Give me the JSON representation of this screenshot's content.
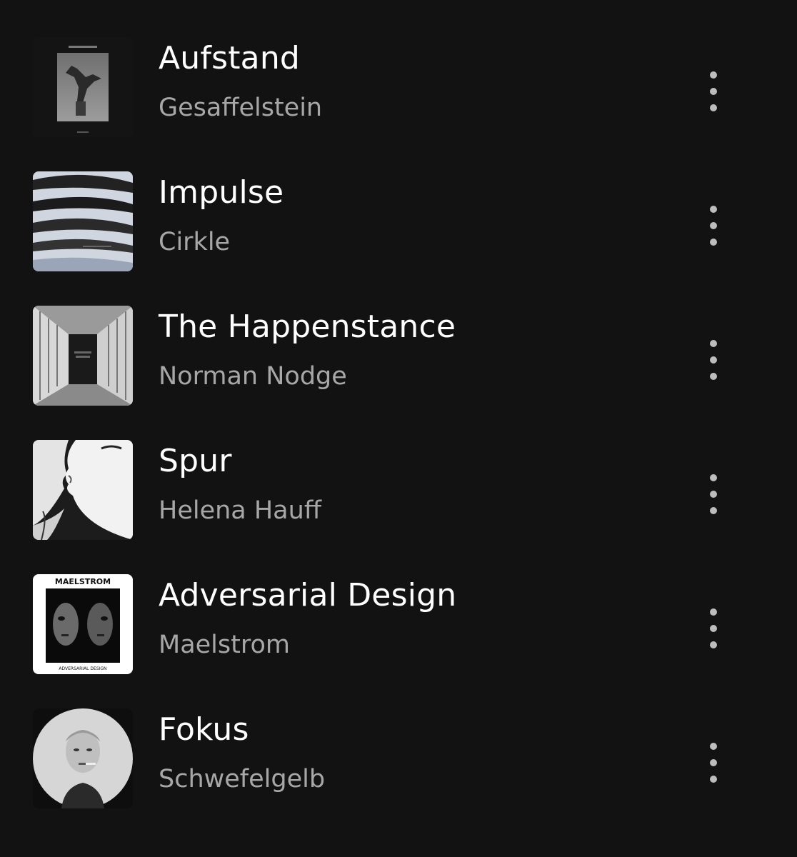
{
  "colors": {
    "background": "#121212",
    "title": "#ffffff",
    "artist": "#a7a7a7",
    "menu_dots": "#bdbdbd"
  },
  "tracks": [
    {
      "title": "Aufstand",
      "artist": "Gesaffelstein",
      "cover_icon": "angel-statue-cover"
    },
    {
      "title": "Impulse",
      "artist": "Cirkle",
      "cover_icon": "water-ripples-cover"
    },
    {
      "title": "The Happenstance",
      "artist": "Norman Nodge",
      "cover_icon": "corridor-cover"
    },
    {
      "title": "Spur",
      "artist": "Helena Hauff",
      "cover_icon": "faces-kiss-cover"
    },
    {
      "title": "Adversarial Design",
      "artist": "Maelstrom",
      "cover_icon": "double-face-cover",
      "cover_text_top": "MAELSTROM",
      "cover_text_bottom": "ADVERSARIAL DESIGN"
    },
    {
      "title": "Fokus",
      "artist": "Schwefelgelb",
      "cover_icon": "portrait-circle-cover"
    }
  ],
  "more_icon": "vertical-dots-icon"
}
